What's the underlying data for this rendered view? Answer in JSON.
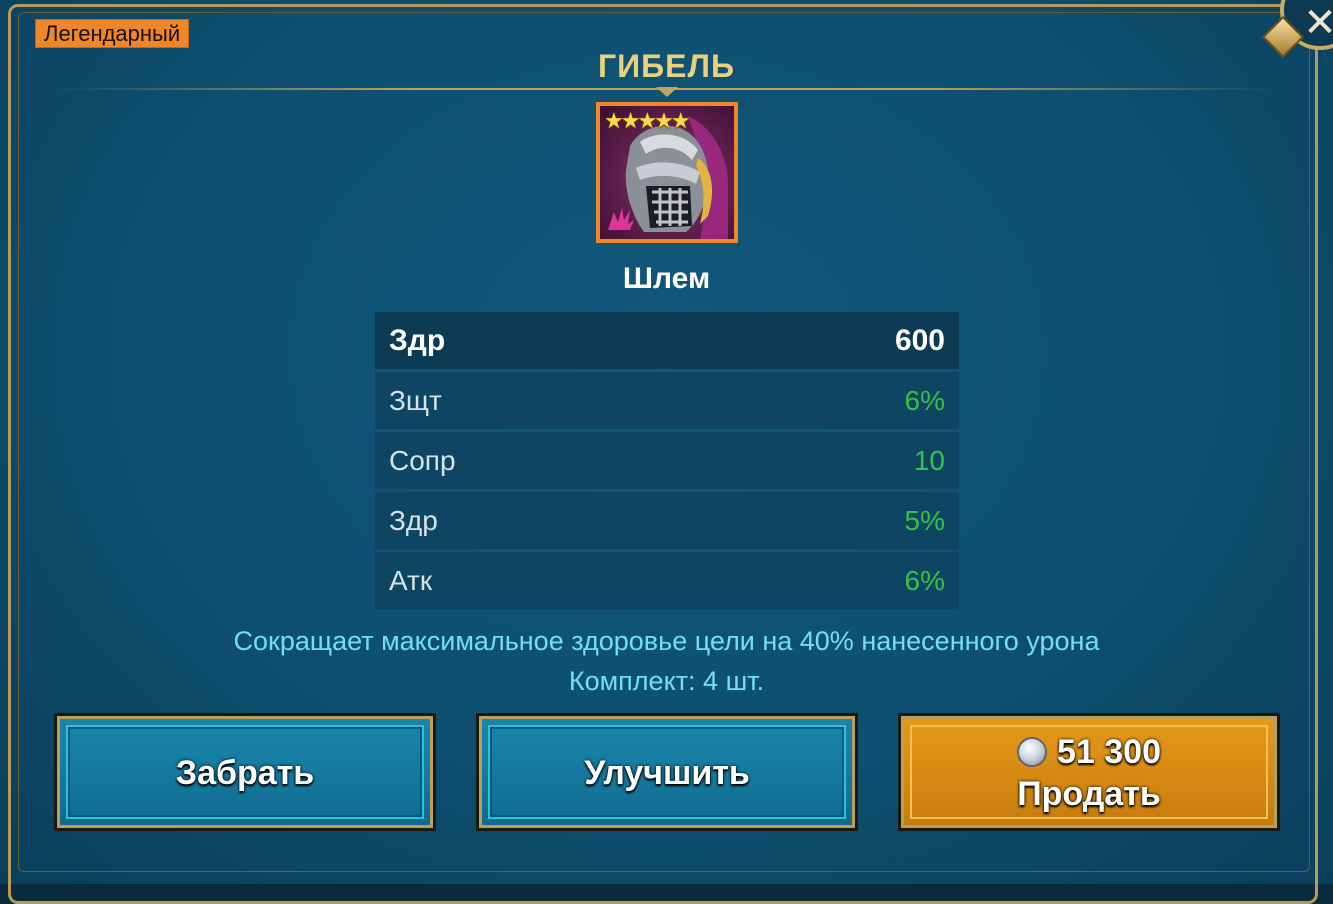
{
  "rarity": "Легендарный",
  "set_name": "ГИБЕЛЬ",
  "item": {
    "name": "Шлем",
    "stars": "★★★★★",
    "rarity_color": "#f0862a"
  },
  "stats": [
    {
      "name": "Здр",
      "value": "600"
    },
    {
      "name": "Зщт",
      "value": "6%"
    },
    {
      "name": "Сопр",
      "value": "10"
    },
    {
      "name": "Здр",
      "value": "5%"
    },
    {
      "name": "Атк",
      "value": "6%"
    }
  ],
  "description": {
    "effect": "Сокращает максимальное здоровье цели на 40% нанесенного урона",
    "set_size": "Комплект: 4 шт."
  },
  "buttons": {
    "take": "Забрать",
    "upgrade": "Улучшить",
    "sell_price": "51 300",
    "sell": "Продать"
  },
  "icons": {
    "close": "close-icon",
    "coin": "silver-coin-icon",
    "set": "destroy-set-icon"
  },
  "colors": {
    "accent_gold": "#e9d27b",
    "stat_green": "#35c24a",
    "desc_cyan": "#72e0ec",
    "legendary_orange": "#f0862a"
  }
}
